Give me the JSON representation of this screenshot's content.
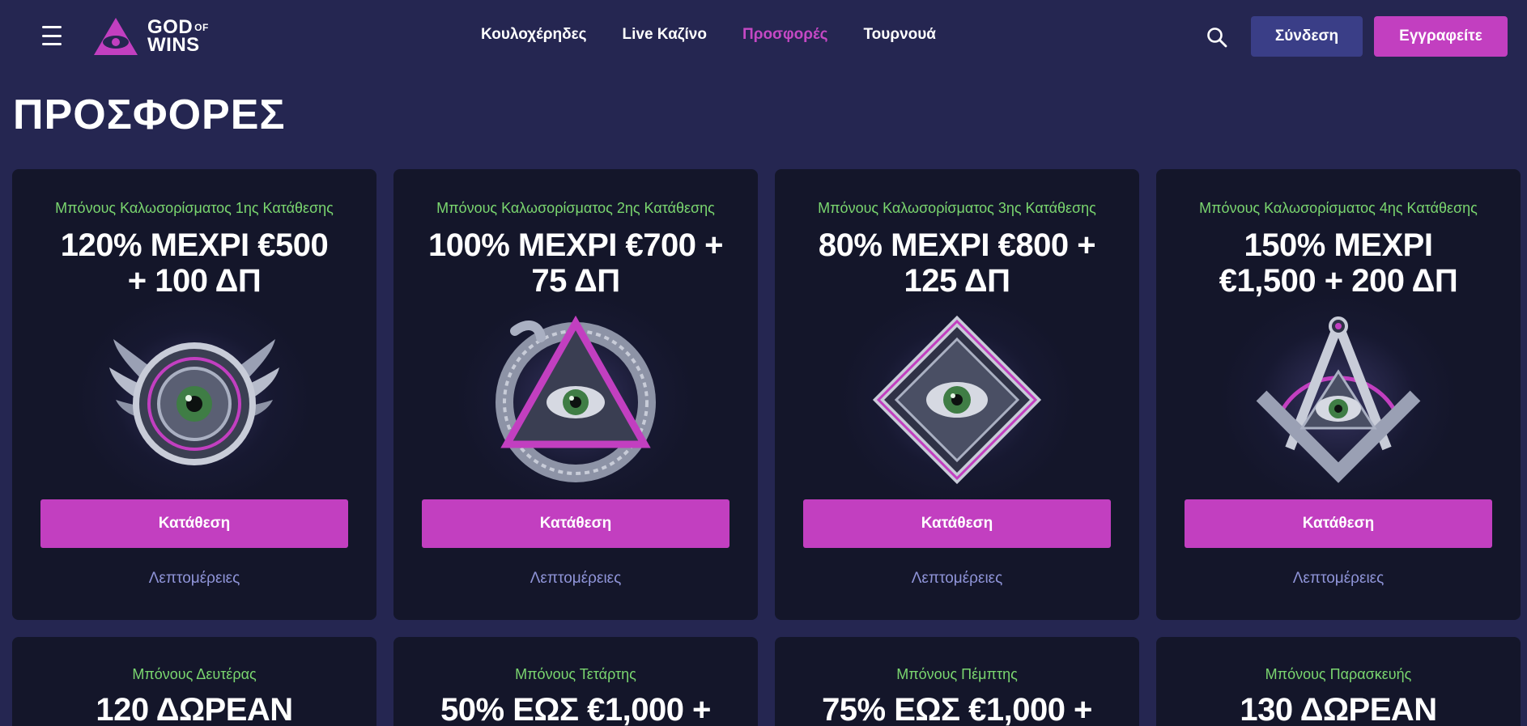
{
  "brand": {
    "logo_top": "GOD",
    "logo_of": "OF",
    "logo_bottom": "WINS"
  },
  "nav": [
    {
      "label": "Κουλοχέρηδες",
      "active": false
    },
    {
      "label": "Live Καζίνο",
      "active": false
    },
    {
      "label": "Προσφορές",
      "active": true
    },
    {
      "label": "Τουρνουά",
      "active": false
    }
  ],
  "header": {
    "login_label": "Σύνδεση",
    "register_label": "Εγγραφείτε"
  },
  "page": {
    "title": "ΠΡΟΣΦΟΡΕΣ"
  },
  "colors": {
    "background": "#252651",
    "card": "#14162a",
    "accent": "#c23fc0",
    "subtitle": "#7ad66f",
    "link": "#8f94d8",
    "login": "#3a3e87"
  },
  "offers": [
    {
      "subtitle": "Μπόνους Καλωσορίσματος 1ης Κατάθεσης",
      "line1": "120% ΜΕΧΡΙ €500",
      "line2": "+ 100 ΔΠ",
      "icon": "winged-eye-icon",
      "button": "Κατάθεση",
      "link": "Λεπτομέρειες"
    },
    {
      "subtitle": "Μπόνους Καλωσορίσματος 2ης Κατάθεσης",
      "line1": "100% ΜΕΧΡΙ €700 +",
      "line2": "75 ΔΠ",
      "icon": "serpent-triangle-eye-icon",
      "button": "Κατάθεση",
      "link": "Λεπτομέρειες"
    },
    {
      "subtitle": "Μπόνους Καλωσορίσματος 3ης Κατάθεσης",
      "line1": "80% ΜΕΧΡΙ €800 +",
      "line2": "125 ΔΠ",
      "icon": "diamond-eye-icon",
      "button": "Κατάθεση",
      "link": "Λεπτομέρειες"
    },
    {
      "subtitle": "Μπόνους Καλωσορίσματος 4ης Κατάθεσης",
      "line1": "150% ΜΕΧΡΙ",
      "line2": "€1,500 + 200 ΔΠ",
      "icon": "compass-square-eye-icon",
      "button": "Κατάθεση",
      "link": "Λεπτομέρειες"
    }
  ],
  "offers_row2": [
    {
      "subtitle": "Μπόνους Δευτέρας",
      "line1": "120 ΔΩΡΕΑΝ"
    },
    {
      "subtitle": "Μπόνους Τετάρτης",
      "line1": "50% ΕΩΣ €1,000 +"
    },
    {
      "subtitle": "Μπόνους Πέμπτης",
      "line1": "75% ΕΩΣ €1,000 +"
    },
    {
      "subtitle": "Μπόνους Παρασκευής",
      "line1": "130 ΔΩΡΕΑΝ"
    }
  ]
}
